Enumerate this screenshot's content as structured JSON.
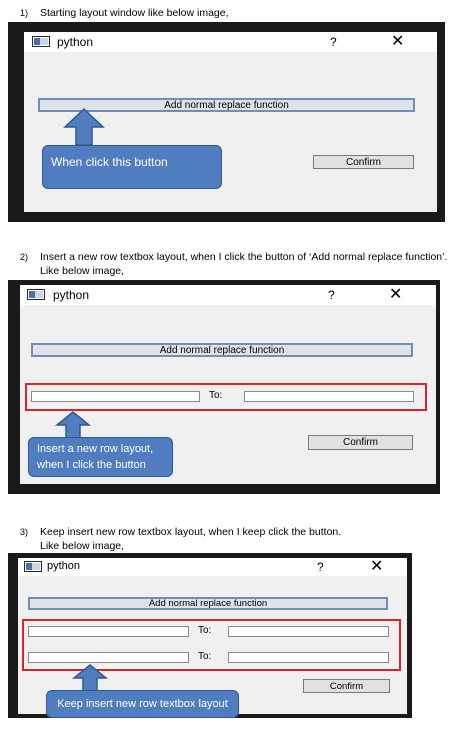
{
  "steps": [
    {
      "number": "1)",
      "line1": "Starting layout window like below image,",
      "line2": ""
    },
    {
      "number": "2)",
      "line1": "Insert a new row textbox layout, when I click the button of ‘Add normal replace function’.",
      "line2": "Like below image,"
    },
    {
      "number": "3)",
      "line1": "Keep insert new row textbox layout, when I keep click the button.",
      "line2": "Like below image,"
    }
  ],
  "window": {
    "title": "python",
    "help_glyph": "?",
    "close_glyph": "✕",
    "add_button_label": "Add normal replace function",
    "to_label": "To:",
    "confirm_label": "Confirm"
  },
  "callouts": {
    "one": "When click this button",
    "two_line1": "Insert a new row layout,",
    "two_line2": "when I click the button",
    "three": "Keep insert new row textbox layout"
  },
  "colors": {
    "callout_fill": "#4f7dc0",
    "highlight_border": "#d9242a",
    "frame": "#1a1a1a"
  }
}
